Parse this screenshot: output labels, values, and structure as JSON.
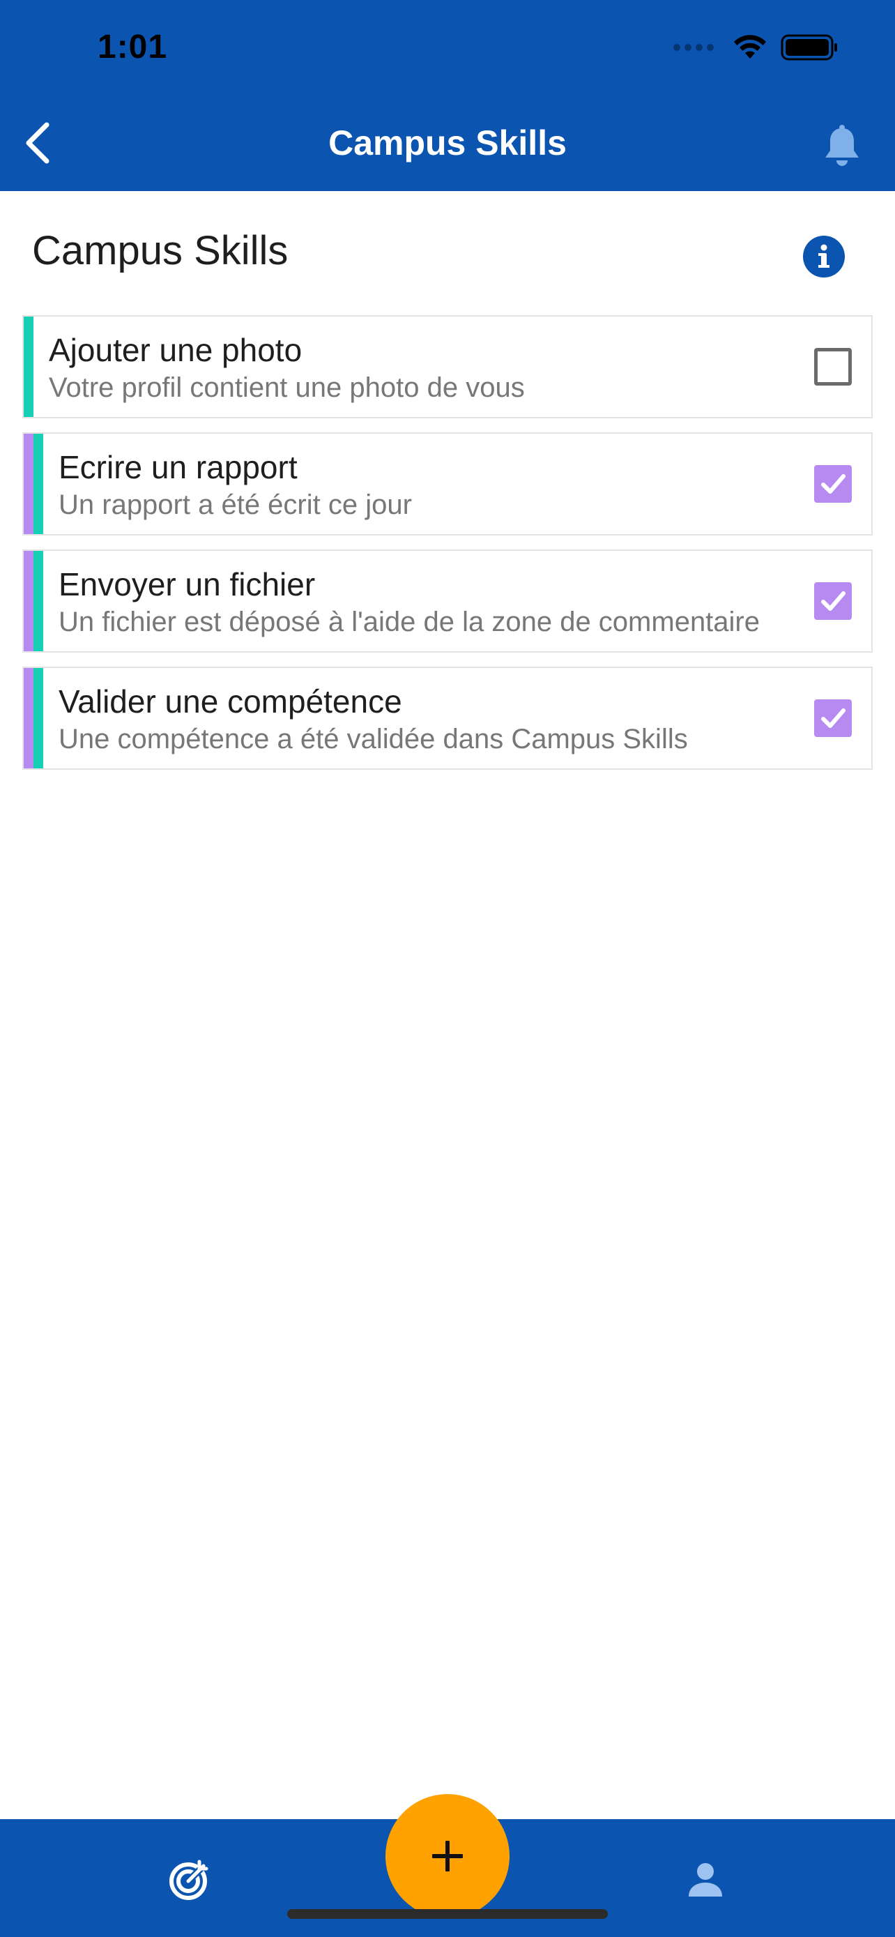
{
  "status_bar": {
    "time": "1:01"
  },
  "nav_bar": {
    "title": "Campus Skills",
    "back_icon": "chevron-left-icon",
    "bell_icon": "bell-icon"
  },
  "page": {
    "title": "Campus Skills",
    "info_icon": "info-icon"
  },
  "colors": {
    "primary": "#0b54b0",
    "accent_teal": "#17cfb5",
    "accent_purple": "#b68af0",
    "fab": "#ffa200"
  },
  "tasks": [
    {
      "title": "Ajouter une photo",
      "description": "Votre profil contient une photo de vous",
      "checked": false
    },
    {
      "title": "Ecrire un rapport",
      "description": "Un rapport a été écrit ce jour",
      "checked": true
    },
    {
      "title": "Envoyer un fichier",
      "description": "Un fichier est déposé à l'aide de la zone de commentaire",
      "checked": true
    },
    {
      "title": "Valider une compétence",
      "description": "Une compétence a été validée dans Campus Skills",
      "checked": true
    }
  ],
  "bottom_nav": {
    "left_icon": "target-icon",
    "fab_icon": "plus-icon",
    "right_icon": "person-icon"
  }
}
